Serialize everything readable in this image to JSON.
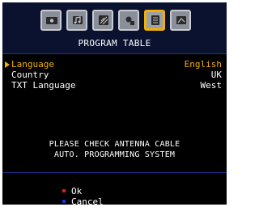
{
  "header": {
    "title": "PROGRAM TABLE",
    "tabs": [
      {
        "icon": "picture-icon"
      },
      {
        "icon": "sound-icon"
      },
      {
        "icon": "settings-icon"
      },
      {
        "icon": "setup-icon"
      },
      {
        "icon": "program-table-icon",
        "active": true
      },
      {
        "icon": "feature-icon"
      }
    ]
  },
  "menu": {
    "items": [
      {
        "label": "Language",
        "value": "English",
        "selected": true
      },
      {
        "label": "Country",
        "value": "UK"
      },
      {
        "label": "TXT Language",
        "value": "West"
      }
    ]
  },
  "message": {
    "line1": "PLEASE CHECK ANTENNA CABLE",
    "line2": "AUTO. PROGRAMMING SYSTEM"
  },
  "footer": {
    "ok": {
      "label": "Ok",
      "color": "#e11b1b"
    },
    "cancel": {
      "label": "Cancel",
      "color": "#2232c9"
    }
  },
  "colors": {
    "accent": "#f2b100",
    "divider": "#1e2f9c",
    "header_bg": "#0a1230"
  }
}
